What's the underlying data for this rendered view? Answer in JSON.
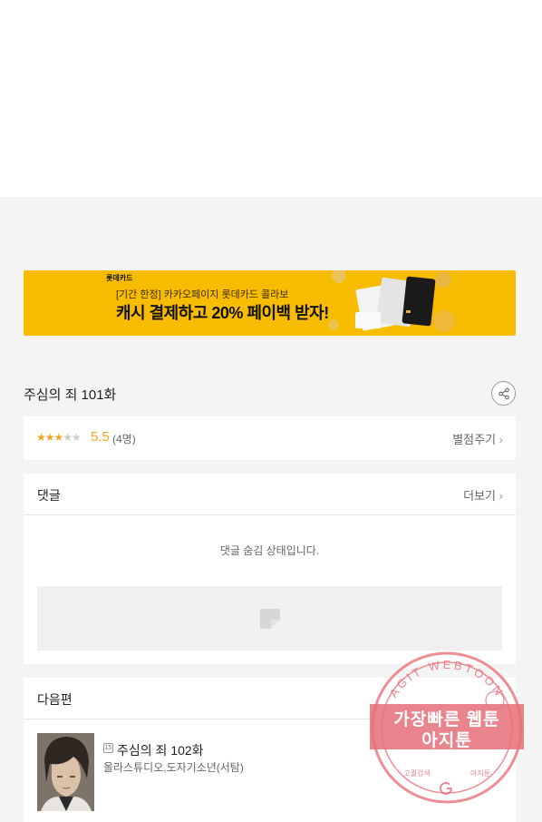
{
  "banner": {
    "brand": "롯데카드",
    "subtitle": "[기간 한정] 카카오페이지 롯데카드 콜라보",
    "headline": "캐시 결제하고 20% 페이백 받자!"
  },
  "episode": {
    "title": "주심의 죄 101화"
  },
  "rating": {
    "score": "5.5",
    "count": "(4명)",
    "stars_filled": 3,
    "stars_total": 5,
    "rate_label": "별점주기"
  },
  "comments": {
    "title": "댓글",
    "more_label": "더보기",
    "hidden_message": "댓글 숨김 상태입니다."
  },
  "next_episode": {
    "section_title": "다음편",
    "age_badge": "15",
    "title": "주심의 죄 102화",
    "author": "올라스튜디오,도자기소년(서탐)"
  },
  "watermark": {
    "ring_text": "AGIT WEBTOON",
    "line1": "가장빠른 웹툰",
    "line2": "아지툰",
    "bottom_left": "고퀄검색",
    "bottom_right": "아지툰",
    "color": "#e8727c"
  },
  "colors": {
    "banner_bg": "#f7bc00",
    "star": "#f5a623",
    "page_bg": "#f4f4f4"
  }
}
